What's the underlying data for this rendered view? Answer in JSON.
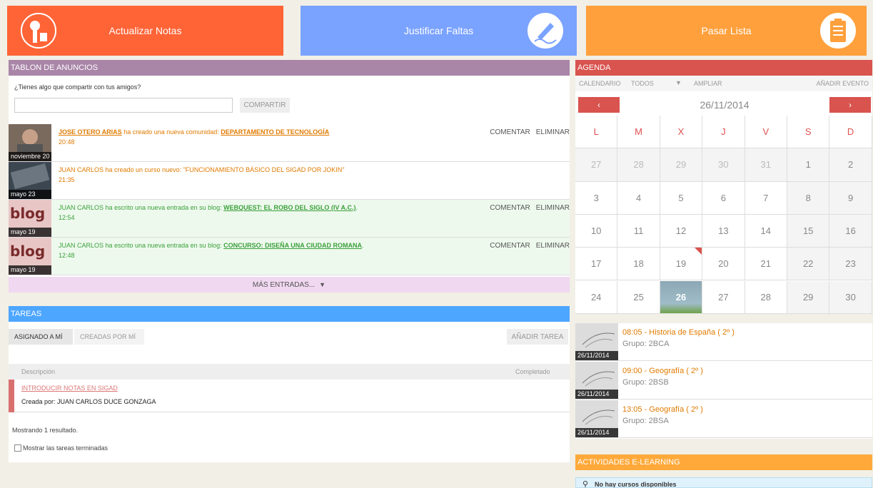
{
  "tiles": {
    "update_grades": "Actualizar Notas",
    "justify_absences": "Justificar Faltas",
    "take_attendance": "Pasar Lista"
  },
  "board": {
    "header": "TABLON DE ANUNCIOS",
    "prompt": "¿Tienes algo que compartir con tus amigos?",
    "share_input_value": "",
    "share_button": "COMPARTIR",
    "items": [
      {
        "date": "noviembre 20",
        "author": "JOSE OTERO ARIAS",
        "action": " ha creado una nueva comunidad: ",
        "target": "DEPARTAMENTO DE TECNOLOGÍA",
        "time": "20:48",
        "comment": "COMENTAR",
        "delete": "ELIMINAR"
      },
      {
        "date": "mayo 23",
        "text": "JUAN CARLOS ha creado un curso nuevo: \"FUNCIONAMIENTO BÁSICO DEL SIGAD POR JOKIN\"",
        "time": "21:35"
      },
      {
        "date": "mayo 19",
        "prefix": "JUAN CARLOS ha escrito una nueva entrada en su blog: ",
        "target": "WEBQUEST: EL ROBO DEL SIGLO (IV A.C.)",
        "suffix": ".",
        "time": "12:54",
        "comment": "COMENTAR",
        "delete": "ELIMINAR"
      },
      {
        "date": "mayo 19",
        "prefix": "JUAN CARLOS ha escrito una nueva entrada en su blog: ",
        "target": "CONCURSO: DISEÑA UNA CIUDAD ROMANA",
        "suffix": ".",
        "time": "12:48",
        "comment": "COMENTAR",
        "delete": "ELIMINAR"
      }
    ],
    "more": "MÁS ENTRADAS..."
  },
  "tasks": {
    "header": "TAREAS",
    "tab_assigned": "ASIGNADO A MÍ",
    "tab_created": "CREADAS POR MÍ",
    "add_button": "AÑADIR TAREA",
    "col_description": "Descripción",
    "col_completed": "Completado",
    "rows": [
      {
        "title": "INTRODUCIR NOTAS EN SIGAD",
        "created_by": "Creada por: JUAN CARLOS DUCE GONZAGA"
      }
    ],
    "showing": "Mostrando 1 resultado.",
    "show_finished": "Mostrar las tareas terminadas"
  },
  "agenda": {
    "header": "AGENDA",
    "calendar_label": "CALENDARIO",
    "filter_value": "TODOS",
    "expand": "AMPLIAR",
    "add_event": "AÑADIR EVENTO",
    "current_date": "26/11/2014",
    "weekdays": [
      "L",
      "M",
      "X",
      "J",
      "V",
      "S",
      "D"
    ],
    "weeks": [
      [
        "27",
        "28",
        "29",
        "30",
        "31",
        "1",
        "2"
      ],
      [
        "3",
        "4",
        "5",
        "6",
        "7",
        "8",
        "9"
      ],
      [
        "10",
        "11",
        "12",
        "13",
        "14",
        "15",
        "16"
      ],
      [
        "17",
        "18",
        "19",
        "20",
        "21",
        "22",
        "23"
      ],
      [
        "24",
        "25",
        "26",
        "27",
        "28",
        "29",
        "30"
      ]
    ],
    "events": [
      {
        "date": "26/11/2014",
        "title": "08:05  - Historia de España ( 2º )",
        "group": "Grupo: 2BCA"
      },
      {
        "date": "26/11/2014",
        "title": "09:00  - Geografía ( 2º )",
        "group": "Grupo: 2BSB"
      },
      {
        "date": "26/11/2014",
        "title": "13:05  - Geografía ( 2º )",
        "group": "Grupo: 2BSA"
      }
    ]
  },
  "elearning": {
    "header": "ACTIVIDADES E-LEARNING",
    "empty": "No hay cursos disponibles"
  },
  "colors": {
    "tile_orange_red": "#ff6437",
    "tile_blue": "#7aa2ff",
    "tile_orange": "#ffa03c",
    "board_header": "#a985a8",
    "tasks_header": "#4da6ff",
    "agenda_header": "#d9534f",
    "elearning_header": "#ffa93a"
  }
}
